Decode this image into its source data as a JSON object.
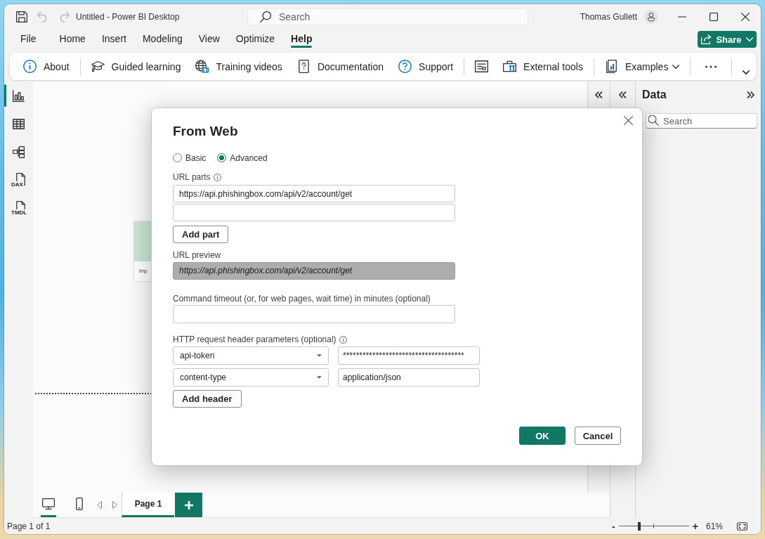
{
  "window": {
    "title": "Untitled - Power BI Desktop"
  },
  "quick_access": [
    {
      "disabled": false
    },
    {
      "disabled": true
    },
    {
      "disabled": true
    }
  ],
  "title_search": {
    "placeholder": "Search"
  },
  "user": {
    "name": "Thomas Gullett"
  },
  "menu": [
    {
      "label": "File",
      "selected": false
    },
    {
      "label": "Home",
      "selected": false
    },
    {
      "label": "Insert",
      "selected": false
    },
    {
      "label": "Modeling",
      "selected": false
    },
    {
      "label": "View",
      "selected": false
    },
    {
      "label": "Optimize",
      "selected": false
    },
    {
      "label": "Help",
      "selected": true
    }
  ],
  "share_button": {
    "label": "Share"
  },
  "ribbon": {
    "groups": [
      {
        "items": [
          {
            "kind": "button",
            "label": "About"
          }
        ]
      },
      {
        "items": [
          {
            "kind": "button",
            "label": "Guided learning"
          },
          {
            "kind": "button",
            "label": "Training videos"
          },
          {
            "kind": "button",
            "label": "Documentation"
          },
          {
            "kind": "button",
            "label": "Support"
          }
        ]
      },
      {
        "items": [
          {
            "kind": "icon_button"
          },
          {
            "kind": "button",
            "label": "External tools"
          }
        ]
      },
      {
        "items": [
          {
            "kind": "dropdown",
            "label": "Examples"
          }
        ]
      },
      {
        "items": [
          {
            "kind": "more"
          }
        ]
      }
    ]
  },
  "nav_rail": [
    {
      "selected": true
    },
    {
      "selected": false
    },
    {
      "selected": false
    },
    {
      "selected": false,
      "badge": "DAX"
    },
    {
      "selected": false,
      "badge": "TMDL"
    }
  ],
  "canvas": {
    "visual": {
      "caption": "Imp"
    }
  },
  "data_pane": {
    "title": "Data",
    "search": {
      "placeholder": "Search"
    }
  },
  "page_bar": {
    "view_toggles": [
      {
        "selected": true
      },
      {
        "selected": false
      }
    ],
    "pages": [
      {
        "label": "Page 1",
        "selected": true
      }
    ]
  },
  "status_bar": {
    "page_info": "Page 1 of 1",
    "zoom": {
      "minus": "-",
      "level": 0.29,
      "plus": "+",
      "reading": "61%"
    }
  },
  "dialog": {
    "title": "From Web",
    "mode_options": [
      {
        "label": "Basic",
        "selected": false
      },
      {
        "label": "Advanced",
        "selected": true
      }
    ],
    "url_parts": {
      "label": "URL parts",
      "values": [
        "https://api.phishingbox.com/api/v2/account/get"
      ]
    },
    "add_part_button": "Add part",
    "url_preview": {
      "label": "URL preview",
      "value": "https://api.phishingbox.com/api/v2/account/get"
    },
    "timeout": {
      "label": "Command timeout (or, for web pages, wait time) in minutes (optional)"
    },
    "headers": {
      "label": "HTTP request header parameters (optional)",
      "rows": [
        {
          "name": "api-token",
          "value": "*************************************"
        },
        {
          "name": "content-type",
          "value": "application/json"
        }
      ]
    },
    "add_header_button": "Add header",
    "buttons": [
      {
        "label": "OK",
        "kind": "primary"
      },
      {
        "label": "Cancel",
        "kind": "secondary"
      }
    ]
  }
}
